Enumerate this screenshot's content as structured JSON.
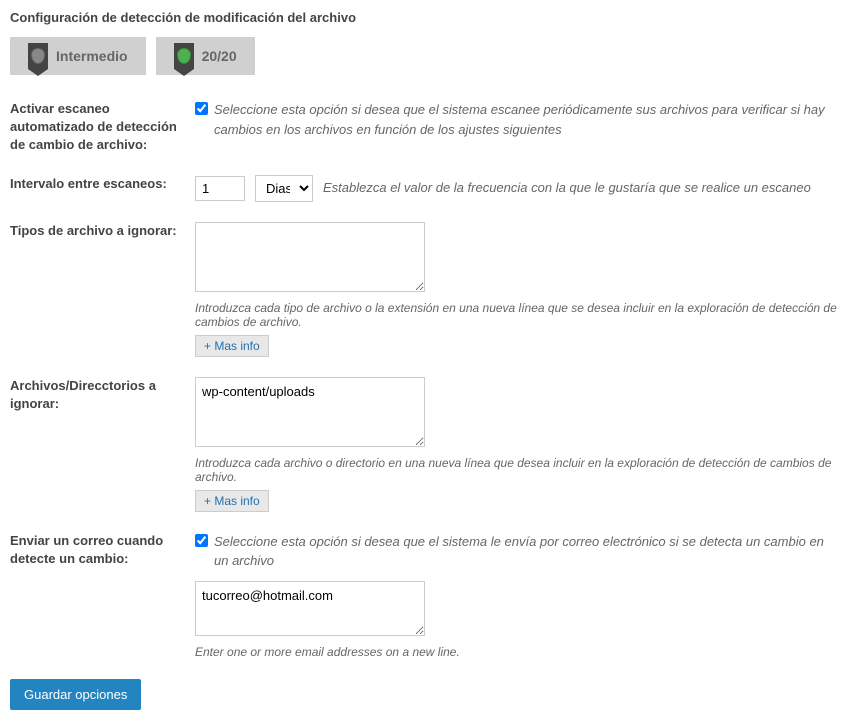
{
  "section_title": "Configuración de detección de modificación del archivo",
  "badges": {
    "level_label": "Intermedio",
    "score": "20/20"
  },
  "rows": {
    "auto_scan": {
      "label": "Activar escaneo automatizado de detección de cambio de archivo:",
      "checkbox_checked": true,
      "help": "Seleccione esta opción si desea que el sistema escanee periódicamente sus archivos para verificar si hay cambios en los archivos en función de los ajustes siguientes"
    },
    "interval": {
      "label": "Intervalo entre escaneos:",
      "value": "1",
      "unit": "Dias",
      "help": "Establezca el valor de la frecuencia con la que le gustaría que se realice un escaneo"
    },
    "ignore_types": {
      "label": "Tipos de archivo a ignorar:",
      "value": "",
      "help": "Introduzca cada tipo de archivo o la extensión en una nueva línea que se desea incluir en la exploración de detección de cambios de archivo.",
      "more_info": "+ Mas info"
    },
    "ignore_dirs": {
      "label": "Archivos/Direcctorios a ignorar:",
      "value": "wp-content/uploads",
      "help": "Introduzca cada archivo o directorio en una nueva línea que desea incluir en la exploración de detección de cambios de archivo.",
      "more_info": "+ Mas info"
    },
    "email_notify": {
      "label": "Enviar un correo cuando detecte un cambio:",
      "checkbox_checked": true,
      "help_top": "Seleccione esta opción si desea que el sistema le envía por correo electrónico si se detecta un cambio en un archivo",
      "value": "tucorreo@hotmail.com",
      "help_bottom": "Enter one or more email addresses on a new line."
    }
  },
  "save_label": "Guardar opciones"
}
